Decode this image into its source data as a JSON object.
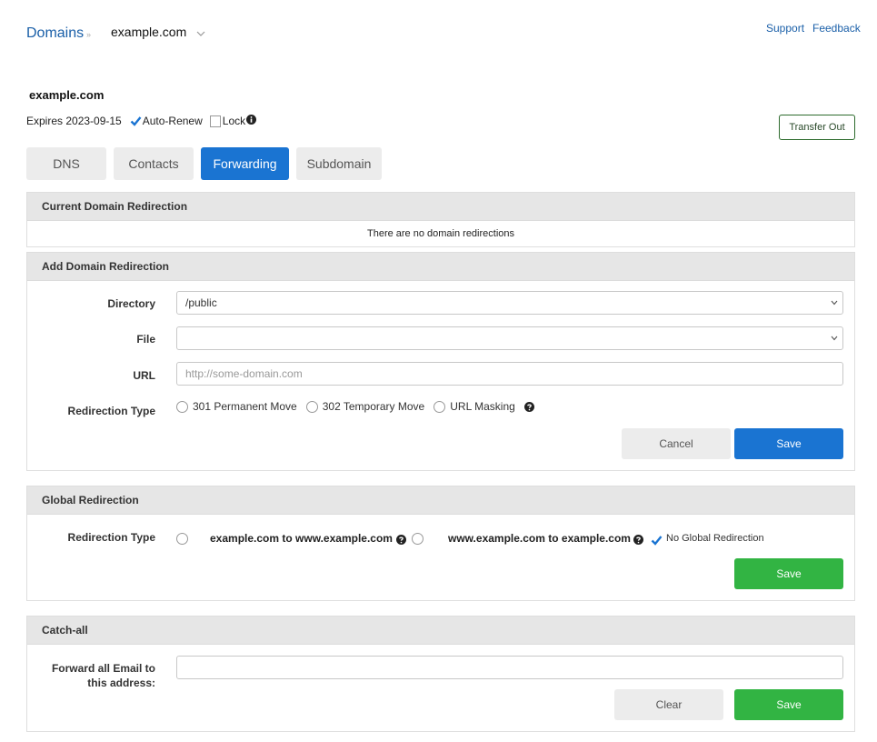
{
  "header": {
    "breadcrumb_root": "Domains",
    "breadcrumb_separator": "»",
    "current_domain": "example.com",
    "links": {
      "support": "Support",
      "feedback": "Feedback"
    }
  },
  "domain": {
    "name": "example.com",
    "expires_label": "Expires 2023-09-15",
    "auto_renew_label": "Auto-Renew",
    "auto_renew_checked": true,
    "lock_label": "Lock",
    "lock_checked": false,
    "transfer_out_label": "Transfer Out"
  },
  "tabs": [
    {
      "label": "DNS",
      "active": false
    },
    {
      "label": "Contacts",
      "active": false
    },
    {
      "label": "Forwarding",
      "active": true
    },
    {
      "label": "Subdomain",
      "active": false
    }
  ],
  "current_redirection": {
    "title": "Current Domain Redirection",
    "empty_message": "There are no domain redirections"
  },
  "add_redirection": {
    "title": "Add Domain Redirection",
    "directory_label": "Directory",
    "directory_value": "/public",
    "file_label": "File",
    "file_value": "",
    "url_label": "URL",
    "url_value": "",
    "url_placeholder": "http://some-domain.com",
    "type_label": "Redirection Type",
    "type_options": [
      "301 Permanent Move",
      "302 Temporary Move",
      "URL Masking"
    ],
    "cancel_label": "Cancel",
    "save_label": "Save"
  },
  "global_redirection": {
    "title": "Global Redirection",
    "type_label": "Redirection Type",
    "option_to_www": "example.com to www.example.com",
    "option_from_www": "www.example.com to example.com",
    "option_none": "No Global Redirection",
    "selected": "none",
    "save_label": "Save"
  },
  "catch_all": {
    "title": "Catch-all",
    "label_line1": "Forward all Email to",
    "label_line2": "this address:",
    "email_value": "",
    "clear_label": "Clear",
    "save_label": "Save"
  },
  "colors": {
    "primary_blue": "#1a74d2",
    "link_blue": "#1a5fa8",
    "success_green": "#32b443",
    "transfer_border": "#2d6b2d"
  }
}
